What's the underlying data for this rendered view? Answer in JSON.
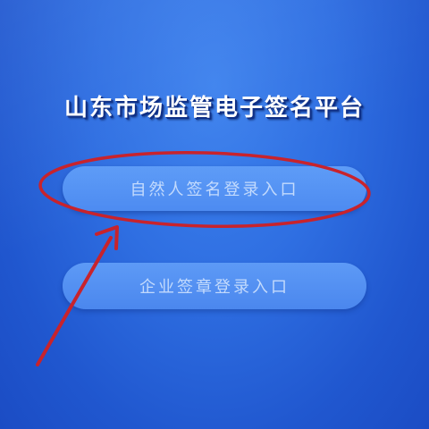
{
  "page": {
    "title": "山东市场监管电子签名平台"
  },
  "buttons": {
    "natural_person_login": "自然人签名登录入口",
    "enterprise_login": "企业签章登录入口"
  },
  "colors": {
    "background": "#2f6fe2",
    "button": "#5e9cf7",
    "annotation": "#c8232c"
  }
}
